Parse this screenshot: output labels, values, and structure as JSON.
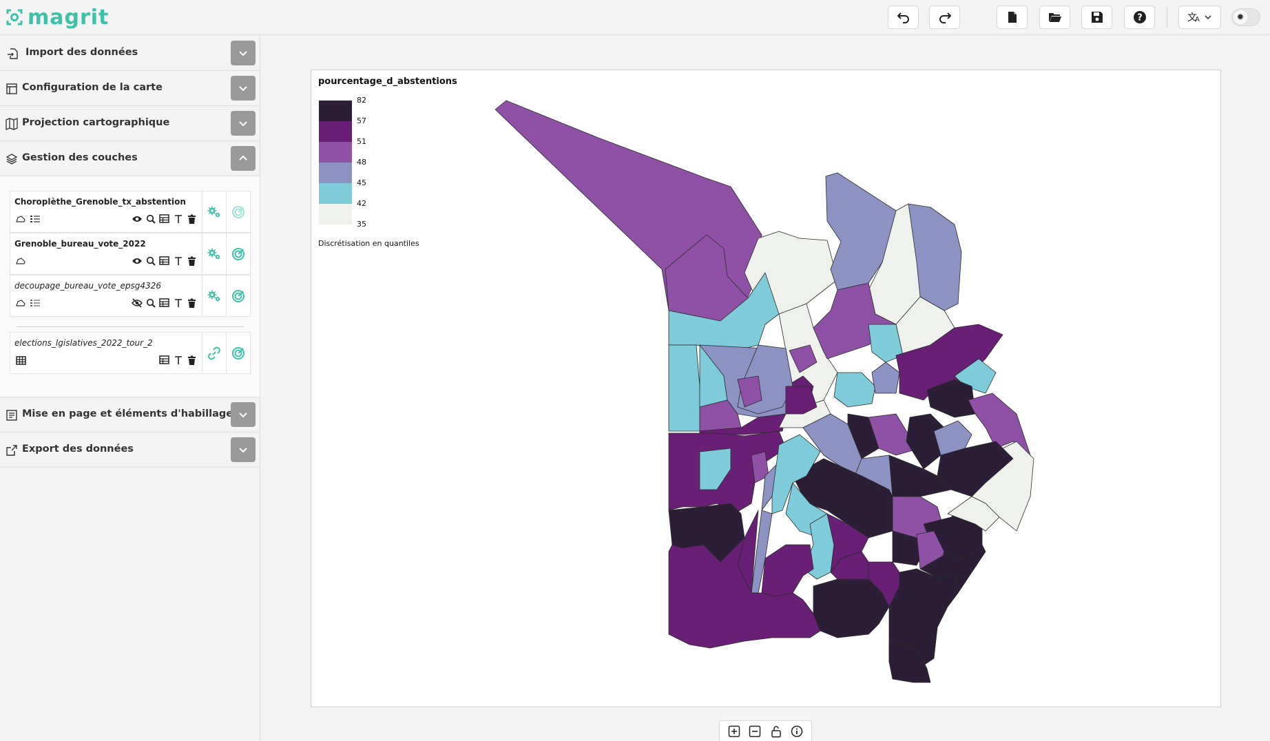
{
  "app": {
    "logo_text": "magrit"
  },
  "toolbar": {
    "buttons": [
      "undo-icon",
      "redo-icon",
      "new-project-icon",
      "open-project-icon",
      "save-project-icon",
      "help-icon"
    ],
    "language_icon": "translate-icon",
    "theme_icon": "gear-sun-icon"
  },
  "sidebar": {
    "sections": {
      "import": "Import des données",
      "map_config": "Configuration de la carte",
      "projection": "Projection cartographique",
      "layers": "Gestion des couches",
      "layout": "Mise en page et éléments d'habillage",
      "export": "Export des données"
    },
    "layers": [
      {
        "name": "Choroplèthe_Grenoble_tx_abstention",
        "italic": false,
        "visible": true,
        "has_legend": true,
        "type": "polygon"
      },
      {
        "name": "Grenoble_bureau_vote_2022",
        "italic": false,
        "visible": true,
        "has_legend": false,
        "type": "polygon"
      },
      {
        "name": "decoupage_bureau_vote_epsg4326",
        "italic": true,
        "visible": false,
        "has_legend": true,
        "type": "polygon"
      },
      {
        "name": "elections_lgislatives_2022_tour_2",
        "italic": true,
        "type": "table"
      }
    ]
  },
  "legend": {
    "title": "pourcentage_d_abstentions",
    "breaks": [
      "82",
      "57",
      "51",
      "48",
      "45",
      "42",
      "35"
    ],
    "colors": [
      "#2b1e36",
      "#6a1f77",
      "#8e51a5",
      "#8c92c1",
      "#7ecbd9",
      "#eff1ed"
    ],
    "note": "Discrétisation en quantiles"
  },
  "colors": {
    "accent": "#3dc1a9",
    "chevron_bg": "#9a9a9a",
    "map_stroke": "#2a2a2a"
  },
  "map_controls": [
    "zoom-in-icon",
    "zoom-out-icon",
    "unlock-icon",
    "info-icon"
  ]
}
